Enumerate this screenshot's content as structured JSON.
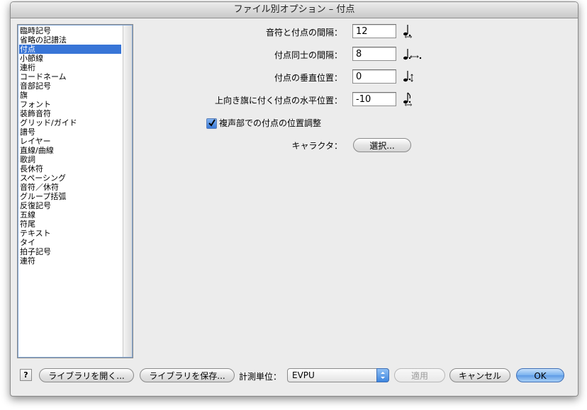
{
  "window": {
    "title": "ファイル別オプション – 付点"
  },
  "sidebar": {
    "items": [
      {
        "label": "臨時記号"
      },
      {
        "label": "省略の記譜法"
      },
      {
        "label": "付点",
        "selected": true
      },
      {
        "label": "小節線"
      },
      {
        "label": "連桁"
      },
      {
        "label": "コードネーム"
      },
      {
        "label": "音部記号"
      },
      {
        "label": "旗"
      },
      {
        "label": "フォント"
      },
      {
        "label": "装飾音符"
      },
      {
        "label": "グリッド/ガイド"
      },
      {
        "label": "譜号"
      },
      {
        "label": "レイヤー"
      },
      {
        "label": "直線/曲線"
      },
      {
        "label": "歌詞"
      },
      {
        "label": "長休符"
      },
      {
        "label": "スペーシング"
      },
      {
        "label": "音符／休符"
      },
      {
        "label": "グループ括弧"
      },
      {
        "label": "反復記号"
      },
      {
        "label": "五線"
      },
      {
        "label": "符尾"
      },
      {
        "label": "テキスト"
      },
      {
        "label": "タイ"
      },
      {
        "label": "拍子記号"
      },
      {
        "label": "連符"
      }
    ]
  },
  "form": {
    "note_dot_spacing": {
      "label": "音符と付点の間隔：",
      "value": "12",
      "icon": "note-dot-horizontal-icon"
    },
    "dot_dot_spacing": {
      "label": "付点同士の間隔：",
      "value": "8",
      "icon": "dot-dot-spacing-icon"
    },
    "dot_vertical": {
      "label": "付点の垂直位置：",
      "value": "0",
      "icon": "dot-vertical-icon"
    },
    "upflag_dot_horizontal": {
      "label": "上向き旗に付く付点の水平位置：",
      "value": "-10",
      "icon": "upflag-dot-icon"
    },
    "multi_voice_adjust": {
      "label": "複声部での付点の位置調整",
      "checked": true
    },
    "character": {
      "label": "キャラクタ：",
      "button": "選択..."
    }
  },
  "footer": {
    "help": "?",
    "open_library": "ライブラリを開く...",
    "save_library": "ライブラリを保存...",
    "unit_label": "計測単位：",
    "unit_value": "EVPU",
    "apply": "適用",
    "cancel": "キャンセル",
    "ok": "OK"
  },
  "colors": {
    "selection": "#3875d7",
    "default_button": "#5d9be6",
    "window_bg": "#ececec"
  }
}
